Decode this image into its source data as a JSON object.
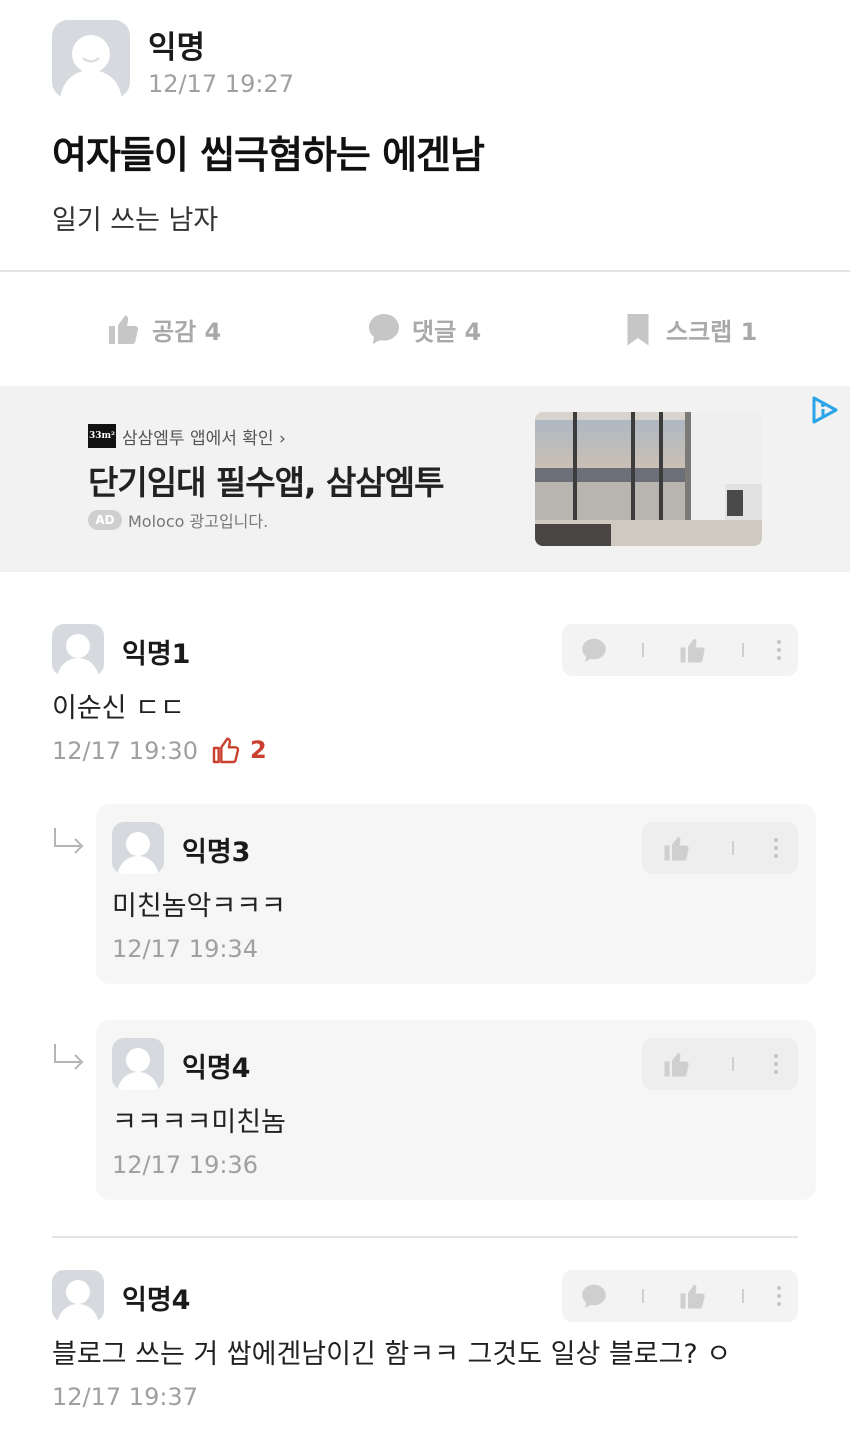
{
  "post": {
    "author": "익명",
    "time": "12/17 19:27",
    "title": "여자들이 씹극혐하는 에겐남",
    "body": "일기 쓰는 남자"
  },
  "actions": {
    "like_label": "공감 4",
    "comment_label": "댓글 4",
    "scrap_label": "스크랩 1"
  },
  "ad": {
    "brand_logo": "33m²",
    "brand": "삼삼엠투 앱에서 확인 ›",
    "title": "단기임대 필수앱, 삼삼엠투",
    "badge": "AD",
    "meta": "Moloco 광고입니다."
  },
  "comments": [
    {
      "name": "익명1",
      "text": "이순신 ㄷㄷ",
      "time": "12/17 19:30",
      "likes": "2"
    },
    {
      "name": "익명3",
      "text": "미친놈악ㅋㅋㅋ",
      "time": "12/17 19:34"
    },
    {
      "name": "익명4",
      "text": "ㅋㅋㅋㅋ미친놈",
      "time": "12/17 19:36"
    },
    {
      "name": "익명4",
      "text": "블로그 쓰는 거 쌉에겐남이긴 함ㅋㅋ 그것도 일상 블로그? ㅇ",
      "time": "12/17 19:37"
    }
  ],
  "colors": {
    "accent_like": "#c9402e",
    "muted": "#a0a0a0",
    "avatar_bg": "#d6d9dd"
  },
  "icons": [
    "thumbs-up-icon",
    "speech-bubble-icon",
    "bookmark-icon",
    "more-dots-icon",
    "reply-arrow-icon",
    "ad-choices-icon"
  ]
}
